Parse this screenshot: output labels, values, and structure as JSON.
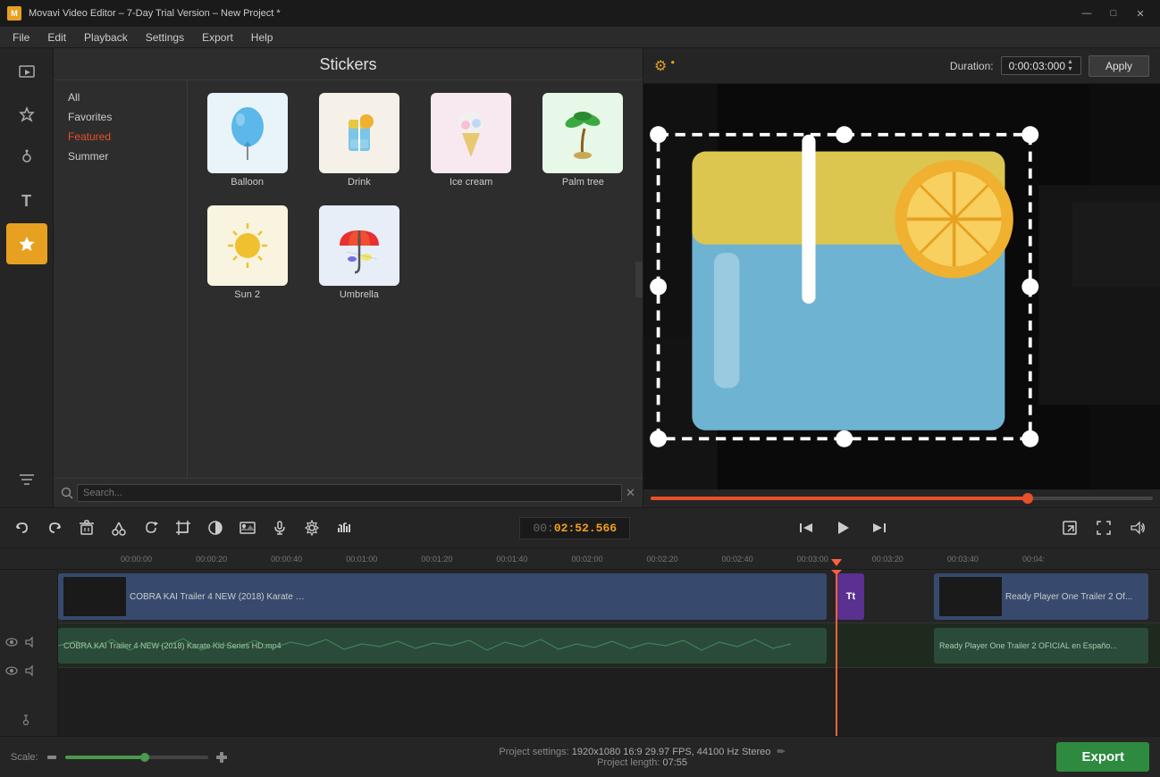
{
  "titlebar": {
    "title": "Movavi Video Editor – 7-Day Trial Version – New Project *",
    "app_icon": "M",
    "win_btns": [
      "—",
      "□",
      "✕"
    ]
  },
  "menubar": {
    "items": [
      "File",
      "Edit",
      "Playback",
      "Settings",
      "Export",
      "Help"
    ]
  },
  "left_sidebar": {
    "buttons": [
      {
        "name": "media-btn",
        "icon": "▶",
        "label": "Media"
      },
      {
        "name": "fx-btn",
        "icon": "✦",
        "label": "FX"
      },
      {
        "name": "audio-btn",
        "icon": "♪",
        "label": "Audio"
      },
      {
        "name": "text-btn",
        "icon": "T",
        "label": "Text"
      },
      {
        "name": "stickers-btn",
        "icon": "★",
        "label": "Stickers",
        "active": true
      },
      {
        "name": "filters-btn",
        "icon": "≡",
        "label": "Filters"
      }
    ]
  },
  "sticker_panel": {
    "title": "Stickers",
    "categories": [
      {
        "label": "All",
        "active": false
      },
      {
        "label": "Favorites",
        "active": false
      },
      {
        "label": "Featured",
        "active": true
      },
      {
        "label": "Summer",
        "active": false
      }
    ],
    "items": [
      {
        "name": "Balloon",
        "emoji": "🎈",
        "class": "balloon-thumb"
      },
      {
        "name": "Drink",
        "emoji": "🥤",
        "class": "drink-thumb"
      },
      {
        "name": "Ice cream",
        "emoji": "🍦",
        "class": "icecream-thumb"
      },
      {
        "name": "Palm tree",
        "emoji": "🌴",
        "class": "palmtree-thumb"
      },
      {
        "name": "Sun 2",
        "emoji": "☀️",
        "class": "sun-thumb"
      },
      {
        "name": "Umbrella",
        "emoji": "⛱",
        "class": "umbrella-thumb"
      }
    ],
    "search_placeholder": "Search..."
  },
  "preview": {
    "gear_icon": "⚙",
    "duration_label": "Duration:",
    "duration_value": "0:00:03:000",
    "apply_label": "Apply",
    "timecode": "00:02:52.566",
    "timecode_prefix": "00:",
    "timecode_bright": "02:52.566",
    "progress_pct": 75
  },
  "playback_controls": {
    "left_btns": [
      {
        "name": "undo-btn",
        "icon": "↩"
      },
      {
        "name": "redo-btn",
        "icon": "↪"
      },
      {
        "name": "delete-btn",
        "icon": "🗑"
      },
      {
        "name": "cut-btn",
        "icon": "✂"
      },
      {
        "name": "rotate-btn",
        "icon": "↺"
      },
      {
        "name": "crop-btn",
        "icon": "⊡"
      },
      {
        "name": "brightness-btn",
        "icon": "◑"
      },
      {
        "name": "image-btn",
        "icon": "🖼"
      },
      {
        "name": "mic-btn",
        "icon": "🎙"
      },
      {
        "name": "settings-btn",
        "icon": "⚙"
      },
      {
        "name": "audio-fx-btn",
        "icon": "⏫"
      }
    ],
    "center_btns": [
      {
        "name": "skip-start-btn",
        "icon": "⏮"
      },
      {
        "name": "play-btn",
        "icon": "▶"
      },
      {
        "name": "skip-end-btn",
        "icon": "⏭"
      }
    ],
    "right_btns": [
      {
        "name": "export-small-btn",
        "icon": "↗"
      },
      {
        "name": "fullscreen-btn",
        "icon": "⛶"
      },
      {
        "name": "volume-btn",
        "icon": "🔊"
      }
    ],
    "timecode": "00:02:52.566"
  },
  "timeline": {
    "ruler_marks": [
      "00:00:00",
      "00:00:20",
      "00:00:40",
      "00:01:00",
      "00:01:20",
      "00:01:40",
      "00:02:00",
      "00:02:20",
      "00:02:40",
      "00:03:00",
      "00:03:20",
      "00:03:40",
      "00:04:"
    ],
    "tracks": [
      {
        "type": "video",
        "label": "COBRA KAI Trailer 4 NEW (2018) Karate Kid Series HD.mp4",
        "label2": "Ready Player One  Trailer 2 Of..."
      },
      {
        "type": "audio",
        "label": "COBRA KAI Trailer 4 NEW (2018) Karate Kid Series HD.mp4",
        "label2": "Ready Player One  Trailer 2 OFICIAL en Españo..."
      }
    ]
  },
  "statusbar": {
    "scale_label": "Scale:",
    "project_settings_label": "Project settings:",
    "project_settings_value": "1920x1080 16:9 29.97 FPS, 44100 Hz Stereo",
    "project_length_label": "Project length:",
    "project_length_value": "07:55",
    "export_label": "Export"
  }
}
